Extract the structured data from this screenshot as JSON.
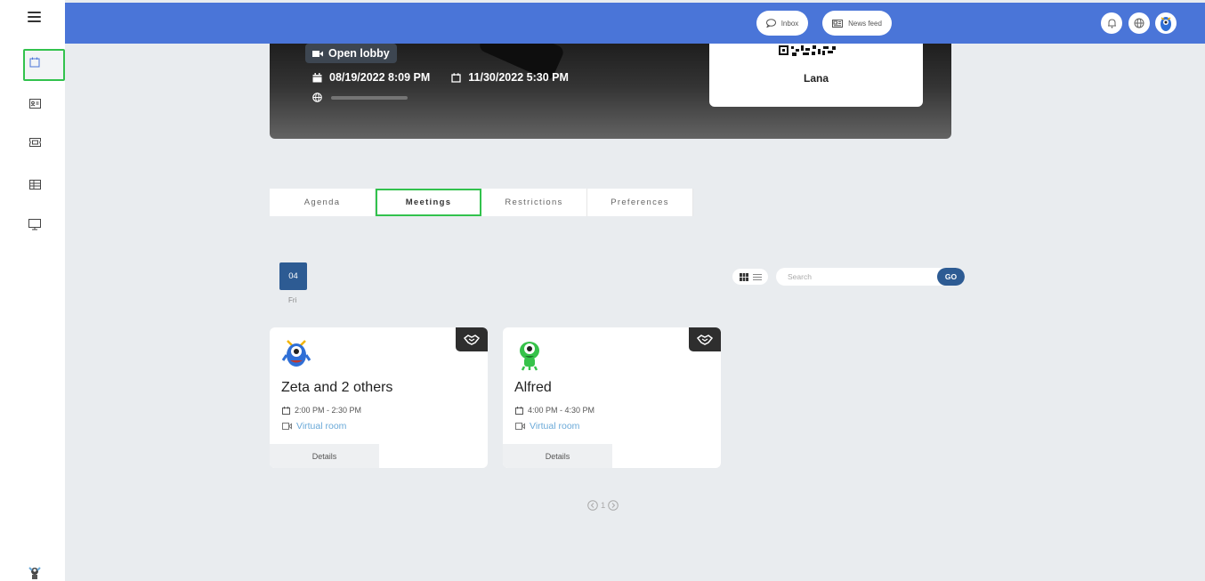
{
  "sidebar": {
    "items": [
      {
        "icon": "calendar-icon",
        "active": true
      },
      {
        "icon": "contact-card-icon",
        "active": false
      },
      {
        "icon": "ticket-icon",
        "active": false
      },
      {
        "icon": "table-icon",
        "active": false
      },
      {
        "icon": "monitor-icon",
        "active": false
      }
    ]
  },
  "topbar": {
    "inbox_label": "Inbox",
    "newsfeed_label": "News feed",
    "color": "#4a75d8"
  },
  "hero": {
    "lobby_label": "Open lobby",
    "start": "08/19/2022 8:09 PM",
    "end": "11/30/2022 5:30 PM",
    "host_name": "Lana"
  },
  "tabs": [
    {
      "label": "Agenda",
      "active": false
    },
    {
      "label": "Meetings",
      "active": true
    },
    {
      "label": "Restrictions",
      "active": false
    },
    {
      "label": "Preferences",
      "active": false
    }
  ],
  "date": {
    "number": "04",
    "day": "Fri"
  },
  "search": {
    "placeholder": "Search",
    "go_label": "GO"
  },
  "meetings": [
    {
      "title": "Zeta and 2 others",
      "time": "2:00 PM - 2:30 PM",
      "room": "Virtual room",
      "details_label": "Details",
      "avatar": "blue-monster"
    },
    {
      "title": "Alfred",
      "time": "4:00 PM - 4:30 PM",
      "room": "Virtual room",
      "details_label": "Details",
      "avatar": "green-monster"
    }
  ],
  "pagination": {
    "current": "1"
  },
  "colors": {
    "accent": "#2d5b93",
    "highlight": "#32c24d",
    "link": "#6aa9d8"
  }
}
